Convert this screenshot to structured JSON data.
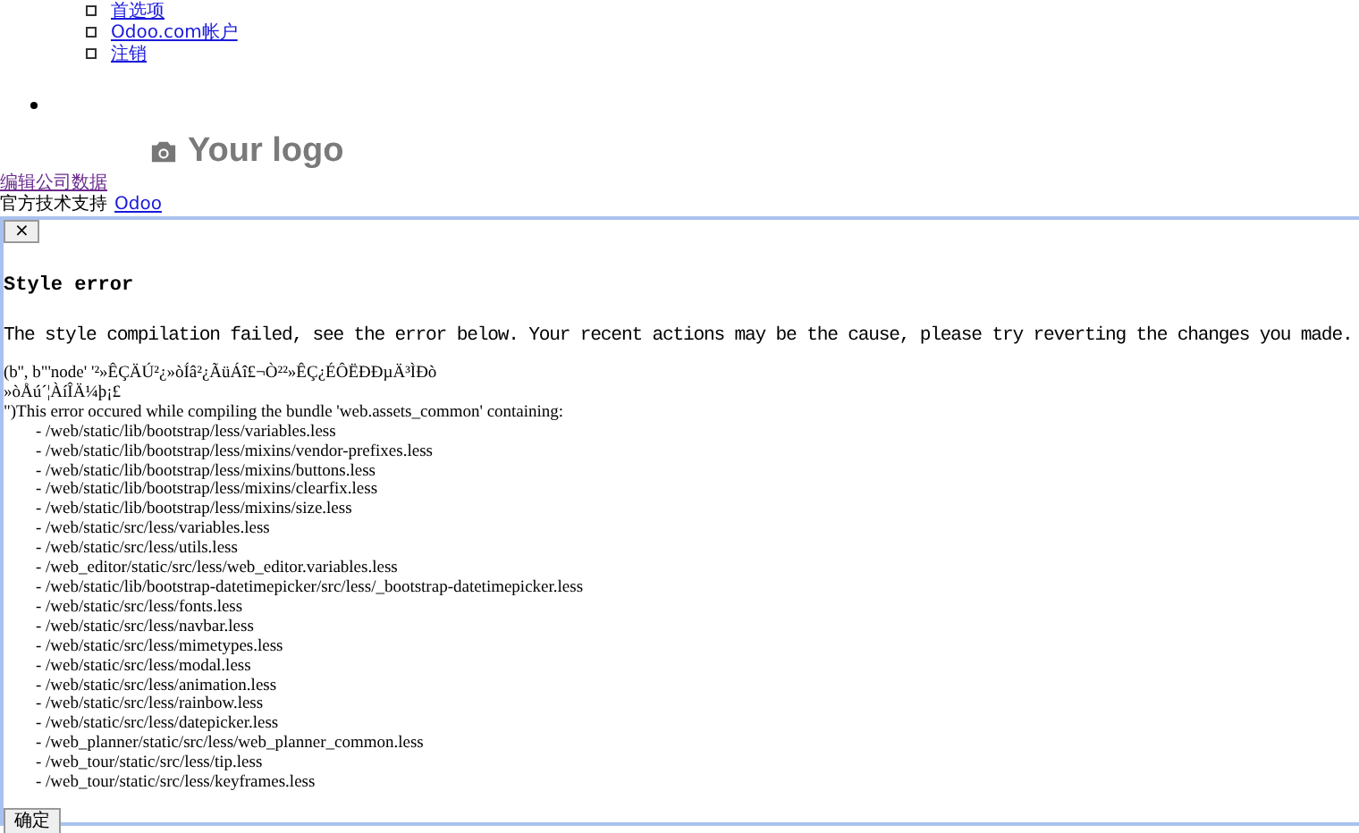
{
  "menu": {
    "links": [
      "首选项",
      "Odoo.com帐户",
      "注销"
    ]
  },
  "logo": {
    "text": "Your logo"
  },
  "edit_company_link": "编辑公司数据",
  "support": {
    "text": "官方技术支持",
    "link": "Odoo"
  },
  "dialog": {
    "close": "×",
    "title": "Style error",
    "message": "The style compilation failed, see the error below. Your recent actions may be the cause, please try reverting the changes you made.",
    "details": [
      "(b'', b\"'node' '²»ÊÇÄÚ²¿»òÍâ²¿ÃüÁî£¬Ò²²»ÊÇ¿ÉÔËÐÐµÄ³ÌÐò",
      "»òÅú´¦ÀíÎÄ¼þ¡£",
      "\")This error occured while compiling the bundle 'web.assets_common' containing:"
    ],
    "files": [
      "- /web/static/lib/bootstrap/less/variables.less",
      "- /web/static/lib/bootstrap/less/mixins/vendor-prefixes.less",
      "- /web/static/lib/bootstrap/less/mixins/buttons.less",
      "- /web/static/lib/bootstrap/less/mixins/clearfix.less",
      "- /web/static/lib/bootstrap/less/mixins/size.less",
      "- /web/static/src/less/variables.less",
      "- /web/static/src/less/utils.less",
      "- /web_editor/static/src/less/web_editor.variables.less",
      "- /web/static/lib/bootstrap-datetimepicker/src/less/_bootstrap-datetimepicker.less",
      "- /web/static/src/less/fonts.less",
      "- /web/static/src/less/navbar.less",
      "- /web/static/src/less/mimetypes.less",
      "- /web/static/src/less/modal.less",
      "- /web/static/src/less/animation.less",
      "- /web/static/src/less/rainbow.less",
      "- /web/static/src/less/datepicker.less",
      "- /web_planner/static/src/less/web_planner_common.less",
      "- /web_tour/static/src/less/tip.less",
      "- /web_tour/static/src/less/keyframes.less"
    ],
    "ok_button": "确定"
  }
}
